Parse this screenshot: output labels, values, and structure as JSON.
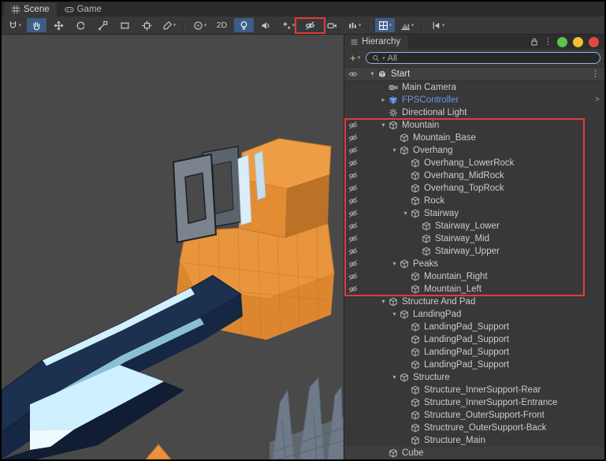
{
  "view_tabs": [
    {
      "label": "Scene",
      "icon": "scene-grid-icon",
      "active": true
    },
    {
      "label": "Game",
      "icon": "game-icon",
      "active": false
    }
  ],
  "toolbar": {
    "items": [
      {
        "id": "tool-settings",
        "icon": "magnet-icon",
        "dropdown": true
      },
      {
        "id": "view-tool",
        "icon": "hand-icon",
        "active": true
      },
      {
        "id": "move-tool",
        "icon": "move-icon"
      },
      {
        "id": "rotate-tool",
        "icon": "rotate-icon"
      },
      {
        "id": "scale-tool",
        "icon": "scale-icon"
      },
      {
        "id": "rect-tool",
        "icon": "rect-icon"
      },
      {
        "id": "transform-tool",
        "icon": "transform-icon"
      },
      {
        "id": "custom-tool",
        "icon": "brush-icon",
        "dropdown": true
      },
      {
        "separator": true
      },
      {
        "id": "pivot-toggle",
        "icon": "pivot-icon",
        "dropdown": true
      },
      {
        "id": "mode-2d",
        "text": "2D"
      },
      {
        "id": "lighting-toggle",
        "icon": "bulb-icon",
        "active": true
      },
      {
        "id": "audio-toggle",
        "icon": "speaker-icon"
      },
      {
        "id": "effects-toggle",
        "icon": "fx-icon",
        "dropdown": true
      },
      {
        "id": "scene-visibility",
        "icon": "eye-slash-icon",
        "annotated": true
      },
      {
        "id": "camera-toggle",
        "icon": "camera-icon"
      },
      {
        "id": "component-filter",
        "icon": "bars-icon",
        "dropdown": true
      },
      {
        "separator": true
      },
      {
        "id": "grid-visibility",
        "icon": "grid-icon",
        "active": true,
        "dropdown": true
      },
      {
        "id": "snap-settings",
        "icon": "ruler-icon",
        "dropdown": true
      },
      {
        "separator": true
      },
      {
        "id": "step-control",
        "icon": "step-icon",
        "dropdown": true
      }
    ]
  },
  "hierarchy": {
    "tab_label": "Hierarchy",
    "create_button": "+",
    "search": {
      "value": "All"
    },
    "window_dots": [
      "#5bc34e",
      "#f1c232",
      "#e4473c"
    ],
    "scene_row": {
      "label": "Start",
      "icon": "unity-scene-icon"
    },
    "rows": [
      {
        "label": "Main Camera",
        "depth": 1,
        "icon": "camera-obj-icon"
      },
      {
        "label": "FPSController",
        "depth": 1,
        "icon": "prefab-icon",
        "fold": "closed",
        "blue": true,
        "trailing": "chevron"
      },
      {
        "label": "Directional Light",
        "depth": 1,
        "icon": "light-icon"
      },
      {
        "label": "Mountain",
        "depth": 1,
        "icon": "cube-icon",
        "fold": "open",
        "hidden": true
      },
      {
        "label": "Mountain_Base",
        "depth": 2,
        "icon": "cube-icon",
        "hidden": true
      },
      {
        "label": "Overhang",
        "depth": 2,
        "icon": "cube-icon",
        "fold": "open",
        "hidden": true
      },
      {
        "label": "Overhang_LowerRock",
        "depth": 3,
        "icon": "cube-icon",
        "hidden": true
      },
      {
        "label": "Overhang_MidRock",
        "depth": 3,
        "icon": "cube-icon",
        "hidden": true
      },
      {
        "label": "Overhang_TopRock",
        "depth": 3,
        "icon": "cube-icon",
        "hidden": true
      },
      {
        "label": "Rock",
        "depth": 3,
        "icon": "cube-icon",
        "hidden": true
      },
      {
        "label": "Stairway",
        "depth": 3,
        "icon": "cube-icon",
        "fold": "open",
        "hidden": true
      },
      {
        "label": "Stairway_Lower",
        "depth": 4,
        "icon": "cube-icon",
        "hidden": true
      },
      {
        "label": "Stairway_Mid",
        "depth": 4,
        "icon": "cube-icon",
        "hidden": true
      },
      {
        "label": "Stairway_Upper",
        "depth": 4,
        "icon": "cube-icon",
        "hidden": true
      },
      {
        "label": "Peaks",
        "depth": 2,
        "icon": "cube-icon",
        "fold": "open",
        "hidden": true
      },
      {
        "label": "Mountain_Right",
        "depth": 3,
        "icon": "cube-icon",
        "hidden": true
      },
      {
        "label": "Mountain_Left",
        "depth": 3,
        "icon": "cube-icon",
        "hidden": true
      },
      {
        "label": "Structure And Pad",
        "depth": 1,
        "icon": "cube-icon",
        "fold": "open"
      },
      {
        "label": "LandingPad",
        "depth": 2,
        "icon": "cube-icon",
        "fold": "open"
      },
      {
        "label": "LandingPad_Support",
        "depth": 3,
        "icon": "cube-icon"
      },
      {
        "label": "LandingPad_Support",
        "depth": 3,
        "icon": "cube-icon"
      },
      {
        "label": "LandingPad_Support",
        "depth": 3,
        "icon": "cube-icon"
      },
      {
        "label": "LandingPad_Support",
        "depth": 3,
        "icon": "cube-icon"
      },
      {
        "label": "Structure",
        "depth": 2,
        "icon": "cube-icon",
        "fold": "open"
      },
      {
        "label": "Structure_InnerSupport-Rear",
        "depth": 3,
        "icon": "cube-icon"
      },
      {
        "label": "Structure_InnerSupport-Entrance",
        "depth": 3,
        "icon": "cube-icon"
      },
      {
        "label": "Structure_OuterSupport-Front",
        "depth": 3,
        "icon": "cube-icon"
      },
      {
        "label": "Structrure_OuterSupport-Back",
        "depth": 3,
        "icon": "cube-icon"
      },
      {
        "label": "Structure_Main",
        "depth": 3,
        "icon": "cube-icon"
      },
      {
        "label": "Cube",
        "depth": 1,
        "icon": "cube-icon",
        "bg": true
      }
    ]
  },
  "annotations": {
    "color": "#e23b3b",
    "toolbar_target": "scene-visibility",
    "hierarchy_from": "Mountain",
    "hierarchy_to": "Mountain_Left"
  },
  "scene_view": {
    "background": "#494949",
    "mountain_color": "#e8923b",
    "structure_color": "#1c3150",
    "highlight_color": "#cff1ff",
    "ghost_color": "#8fa3bc"
  }
}
